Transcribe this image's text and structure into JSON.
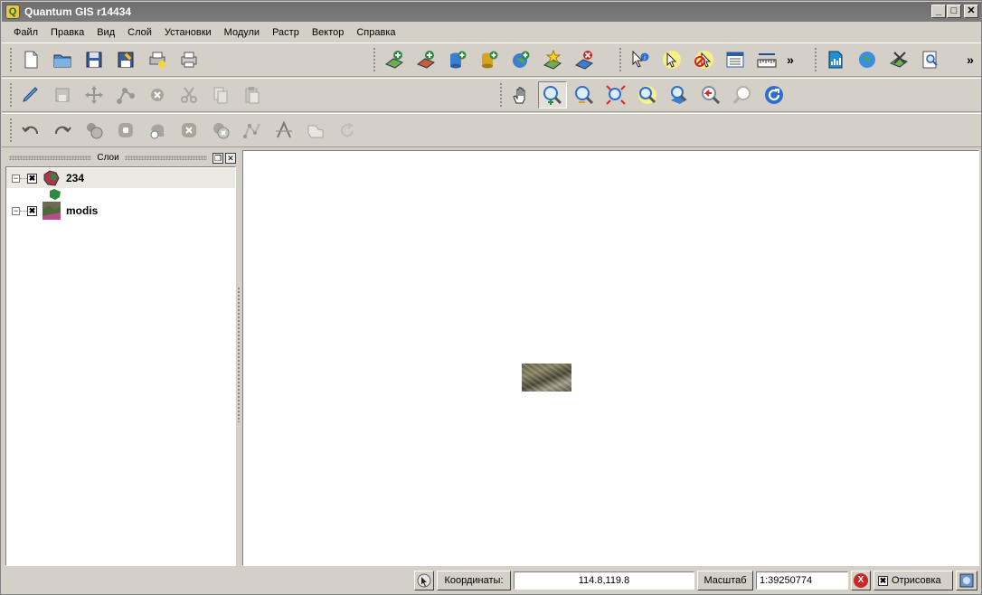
{
  "window": {
    "title": "Quantum GIS r14434",
    "minimize": "_",
    "maximize": "□",
    "close": "✕"
  },
  "menu": [
    "Файл",
    "Правка",
    "Вид",
    "Слой",
    "Установки",
    "Модули",
    "Растр",
    "Вектор",
    "Справка"
  ],
  "toolbars": {
    "more_glyph": "»"
  },
  "layers_panel": {
    "title": "Слои",
    "float_glyph": "❐",
    "close_glyph": "✕",
    "layers": [
      {
        "name": "234",
        "checked": "✖",
        "expander": "−"
      },
      {
        "name": "modis",
        "checked": "✖",
        "expander": "−"
      }
    ]
  },
  "statusbar": {
    "coords_label": "Координаты:",
    "coords_value": "114.8,119.8",
    "scale_label": "Масштаб",
    "scale_value": "1:39250774",
    "stop_glyph": "X",
    "render_check": "✖",
    "render_label": "Отрисовка"
  },
  "colors": {
    "titlebar": "#7a7a7a",
    "chrome": "#d4d0c8",
    "canvas": "#ffffff",
    "accent_green": "#2e8b3e",
    "accent_blue": "#1f6fc9"
  }
}
